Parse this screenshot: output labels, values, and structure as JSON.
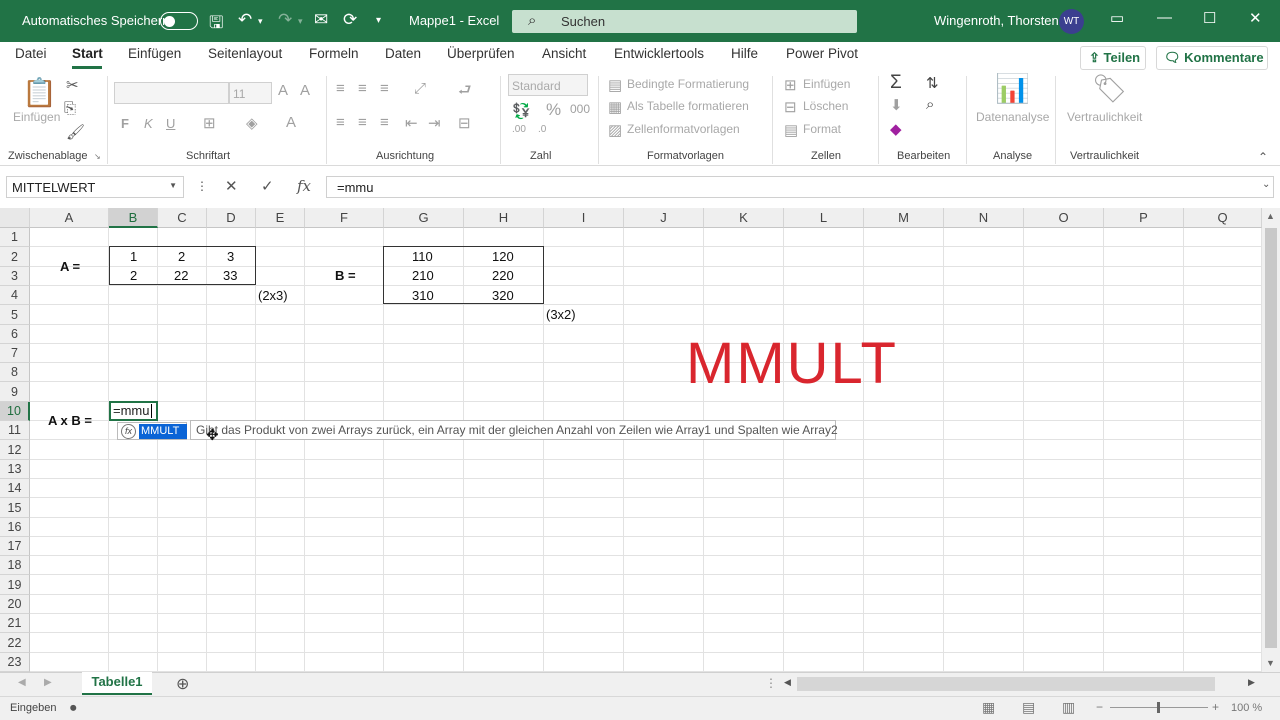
{
  "titlebar": {
    "autosave_label": "Automatisches Speichern",
    "document": "Mappe1  -  Excel",
    "search_placeholder": "Suchen",
    "user_name": "Wingenroth, Thorsten",
    "user_initials": "WT"
  },
  "tabs": [
    "Datei",
    "Start",
    "Einfügen",
    "Seitenlayout",
    "Formeln",
    "Daten",
    "Überprüfen",
    "Ansicht",
    "Entwicklertools",
    "Hilfe",
    "Power Pivot"
  ],
  "active_tab": "Start",
  "share_label": "Teilen",
  "comments_label": "Kommentare",
  "ribbon": {
    "clipboard": {
      "paste": "Einfügen",
      "label": "Zwischenablage"
    },
    "font": {
      "bold": "F",
      "italic": "K",
      "underline": "U",
      "size": "11",
      "label": "Schriftart"
    },
    "alignment": {
      "label": "Ausrichtung"
    },
    "number": {
      "format": "Standard",
      "label": "Zahl"
    },
    "styles": {
      "conditional": "Bedingte Formatierung",
      "as_table": "Als Tabelle formatieren",
      "cell_styles": "Zellenformatvorlagen",
      "label": "Formatvorlagen"
    },
    "cells": {
      "insert": "Einfügen",
      "delete": "Löschen",
      "format": "Format",
      "label": "Zellen"
    },
    "editing": {
      "label": "Bearbeiten"
    },
    "analysis": {
      "data_analysis": "Datenanalyse",
      "label": "Analyse"
    },
    "sensitivity": {
      "button": "Vertraulichkeit",
      "label": "Vertraulichkeit"
    }
  },
  "formula_bar": {
    "name_box": "MITTELWERT",
    "formula": "=mmu"
  },
  "columns": [
    "A",
    "B",
    "C",
    "D",
    "E",
    "F",
    "G",
    "H",
    "I",
    "J",
    "K",
    "L",
    "M",
    "N",
    "O",
    "P",
    "Q"
  ],
  "rows": [
    "1",
    "2",
    "3",
    "4",
    "5",
    "6",
    "7",
    "8",
    "9",
    "10",
    "11",
    "12",
    "13",
    "14",
    "15",
    "16",
    "17",
    "18",
    "19",
    "20",
    "21",
    "22",
    "23"
  ],
  "cells": {
    "a_label": "A =",
    "b_label": "B =",
    "axb_label": "A x B =",
    "matrix_a": [
      [
        "1",
        "2",
        "3"
      ],
      [
        "2",
        "22",
        "33"
      ]
    ],
    "matrix_b": [
      [
        "110",
        "120"
      ],
      [
        "210",
        "220"
      ],
      [
        "310",
        "320"
      ]
    ],
    "dim_a": "(2x3)",
    "dim_b": "(3x2)",
    "big_title": "MMULT",
    "active_value": "=mmu"
  },
  "autocomplete": {
    "fx": "fx",
    "item": "MMULT",
    "tooltip": "Gibt das Produkt von zwei Arrays zurück, ein Array mit der gleichen Anzahl von Zeilen wie Array1 und Spalten wie Array2"
  },
  "sheet_tab": "Tabelle1",
  "status": {
    "mode": "Eingeben",
    "zoom": "100 %"
  },
  "colors": {
    "accent": "#217346",
    "title_red": "#d9262e"
  }
}
